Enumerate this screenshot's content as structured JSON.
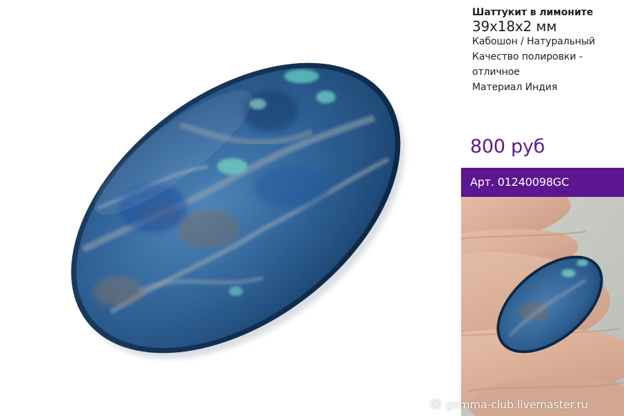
{
  "product": {
    "title": "Шаттукит в лимоните",
    "size": "39x18x2 мм",
    "lines": [
      "Кабошон / Натуральный",
      "Качество полировки -",
      "отличное",
      "Материал Индия"
    ],
    "price": "800 руб",
    "article": "Арт. 01240098GC"
  },
  "watermark": {
    "text": "gemma-club.livemaster.ru",
    "icon": "sun-logo-icon"
  },
  "colors": {
    "accent": "#5b1690",
    "price": "#5b1a8c",
    "stone_base": "#2e5f93",
    "stone_turquoise": "#5ec3c0"
  }
}
